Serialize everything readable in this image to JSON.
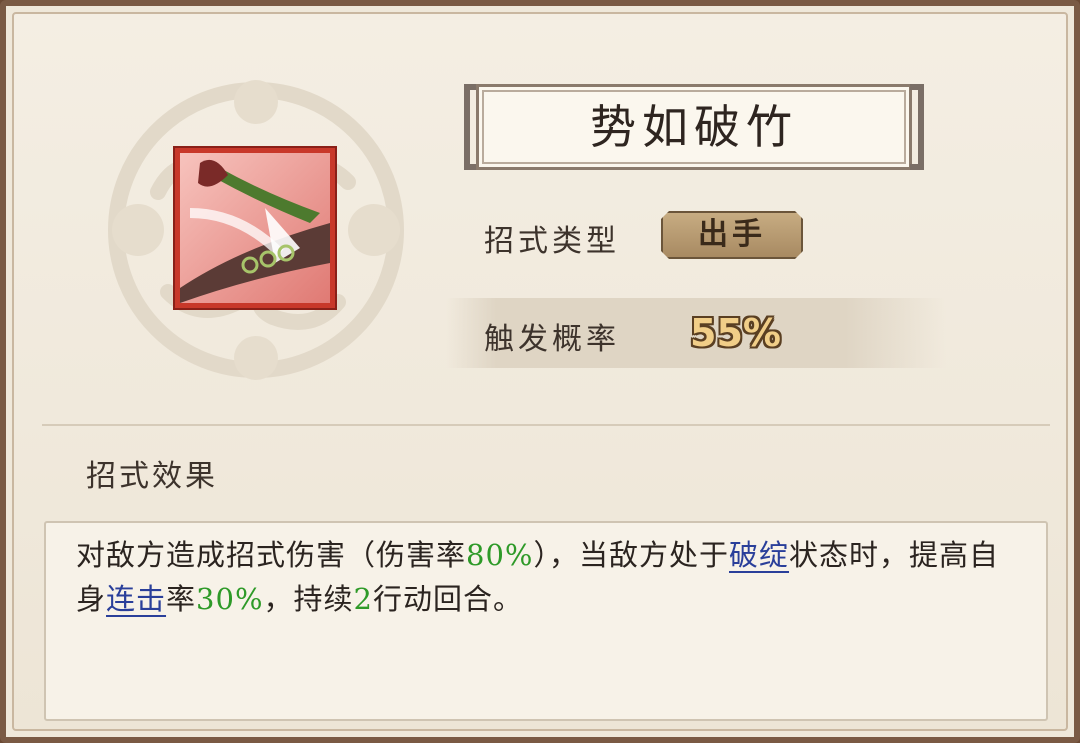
{
  "skill": {
    "name": "势如破竹",
    "icon": "sword-strike-icon",
    "type_label": "招式类型",
    "type_value": "出手",
    "trigger_label": "触发概率",
    "trigger_value": "55%"
  },
  "effect": {
    "section_title": "招式效果",
    "segments": [
      {
        "text": "对敌方造成招式伤害（伤害率",
        "style": "normal"
      },
      {
        "text": "80%",
        "style": "green"
      },
      {
        "text": "），当敌方处于",
        "style": "normal"
      },
      {
        "text": "破绽",
        "style": "link"
      },
      {
        "text": "状态时，提高自身",
        "style": "normal"
      },
      {
        "text": "连击",
        "style": "link"
      },
      {
        "text": "率",
        "style": "normal"
      },
      {
        "text": "30%",
        "style": "green"
      },
      {
        "text": "，持续",
        "style": "normal"
      },
      {
        "text": "2",
        "style": "green"
      },
      {
        "text": "行动回合。",
        "style": "normal"
      }
    ]
  },
  "colors": {
    "highlight_green": "#2e9a28",
    "keyword_blue": "#2a3f9a",
    "icon_border_red": "#c8382a",
    "probability_gold": "#f1ce88"
  }
}
